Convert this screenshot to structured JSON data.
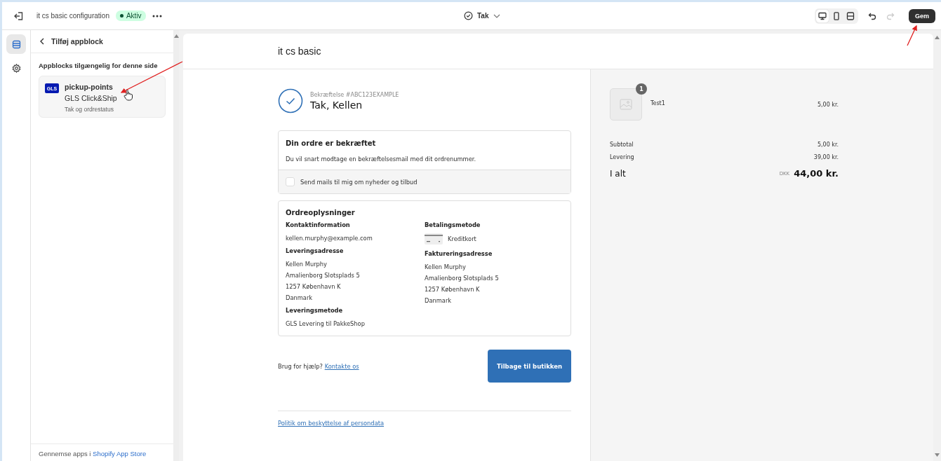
{
  "topbar": {
    "title": "it cs basic configuration",
    "status": "Aktiv",
    "page_selector": "Tak",
    "view_buttons": [
      {
        "kind": "desktop",
        "selected": true
      },
      {
        "kind": "mobile",
        "selected": false
      },
      {
        "kind": "fullscreen",
        "selected": false
      }
    ],
    "redo_disabled": true,
    "save": "Gem"
  },
  "rail": [
    {
      "kind": "sections",
      "selected": true
    },
    {
      "kind": "settings",
      "selected": false
    }
  ],
  "panel": {
    "back": "Tilføj appblock",
    "heading": "Appblocks tilgængelig for denne side",
    "blocks": [
      {
        "name": "pickup-points",
        "app": "GLS Click&Ship",
        "logo": "GLS",
        "page": "Tak og ordrestatus"
      }
    ],
    "footer_text": "Gennemse apps i",
    "footer_link": "Shopify App Store"
  },
  "preview": {
    "shop": "it cs basic",
    "confirmation": "Bekræftelse #ABC123EXAMPLE",
    "thanks": "Tak, Kellen",
    "status_card": {
      "title": "Din ordre er bekræftet",
      "text": "Du vil snart modtage en bekræftelsesmail med dit ordrenummer.",
      "newsletter": {
        "label": "Send mails til mig om nyheder og tilbud",
        "checked": false
      }
    },
    "details": {
      "title": "Ordreoplysninger",
      "left": [
        {
          "label": "Kontaktinformation",
          "lines": [
            "kellen.murphy@example.com"
          ]
        },
        {
          "label": "Leveringsadresse",
          "lines": [
            "Kellen Murphy",
            "Amalienborg Slotsplads 5",
            "1257 København K",
            "Danmark"
          ]
        },
        {
          "label": "Leveringsmetode",
          "lines": [
            "GLS Levering til PakkeShop"
          ]
        }
      ],
      "right": [
        {
          "label": "Betalingsmetode",
          "payment": "Kreditkort"
        },
        {
          "label": "Faktureringsadresse",
          "lines": [
            "Kellen Murphy",
            "Amalienborg Slotsplads 5",
            "1257 København K",
            "Danmark"
          ]
        }
      ]
    },
    "help": "Brug for hjælp?",
    "contact": "Kontakte os",
    "back_button": "Tilbage til butikken",
    "policy": "Politik om beskyttelse af persondata",
    "items": [
      {
        "name": "Test1",
        "quantity": "1",
        "price": "5,00 kr."
      }
    ],
    "totals": [
      {
        "label": "Subtotal",
        "value": "5,00 kr."
      },
      {
        "label": "Levering",
        "value": "39,00 kr."
      }
    ],
    "total": {
      "label": "I alt",
      "currency": "DKK",
      "value": "44,00 kr."
    }
  }
}
